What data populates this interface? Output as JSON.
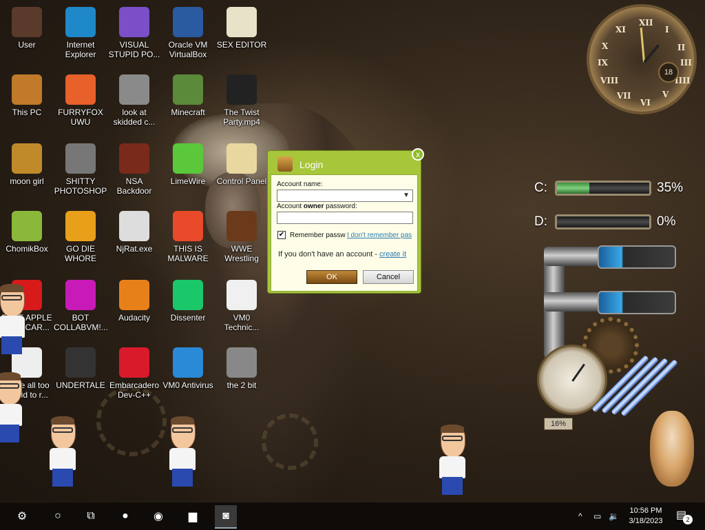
{
  "desktop": {
    "icons": [
      {
        "label": "User",
        "icon": "user-folder-icon",
        "color": "#5a3a2a"
      },
      {
        "label": "Internet Explorer",
        "icon": "edge-icon",
        "color": "#1e88c8"
      },
      {
        "label": "VISUAL STUPID PO...",
        "icon": "visual-studio-icon",
        "color": "#7a4fc8"
      },
      {
        "label": "Oracle VM VirtualBox",
        "icon": "virtualbox-icon",
        "color": "#2a5aa0"
      },
      {
        "label": "SEX EDITOR",
        "icon": "hxd-editor-icon",
        "color": "#e8e2c8"
      },
      {
        "label": "This PC",
        "icon": "this-pc-icon",
        "color": "#c07a2a"
      },
      {
        "label": "FURRYFOX UWU",
        "icon": "firefox-icon",
        "color": "#e8602a"
      },
      {
        "label": "look at skidded c...",
        "icon": "copies-icon",
        "color": "#8a8a8a"
      },
      {
        "label": "Minecraft",
        "icon": "minecraft-icon",
        "color": "#5a8a3a"
      },
      {
        "label": "The Twist Party.mp4",
        "icon": "video-file-icon",
        "color": "#222"
      },
      {
        "label": "moon girl",
        "icon": "moon-girl-icon",
        "color": "#c08a2a"
      },
      {
        "label": "SHITTY PHOTOSHOP",
        "icon": "gimp-icon",
        "color": "#777"
      },
      {
        "label": "NSA Backdoor",
        "icon": "nsa-backdoor-icon",
        "color": "#7a2a1a"
      },
      {
        "label": "LimeWire",
        "icon": "limewire-icon",
        "color": "#5ac83a"
      },
      {
        "label": "Control Panel",
        "icon": "lightbulb-icon",
        "color": "#e8d8a0"
      },
      {
        "label": "ChomikBox",
        "icon": "chomikbox-icon",
        "color": "#8ab83a"
      },
      {
        "label": "GO DIE WHORE",
        "icon": "die-icon",
        "color": "#e8a01a"
      },
      {
        "label": "NjRat.exe",
        "icon": "skull-icon",
        "color": "#ddd"
      },
      {
        "label": "THIS IS MALWARE",
        "icon": "chrome-icon",
        "color": "#e84a2a"
      },
      {
        "label": "WWE Wrestling",
        "icon": "tv-icon",
        "color": "#6a3a1a"
      },
      {
        "label": "FREE APPLE GIFT CAR...",
        "icon": "apple-icon",
        "color": "#d81a1a"
      },
      {
        "label": "BOT COLLABVM!...",
        "icon": "monitor-icon",
        "color": "#c81ab8"
      },
      {
        "label": "Audacity",
        "icon": "audacity-icon",
        "color": "#e8801a"
      },
      {
        "label": "Dissenter",
        "icon": "dissenter-icon",
        "color": "#1ac86a"
      },
      {
        "label": "VM0 Technic...",
        "icon": "technician-icon",
        "color": "#f0f0f0"
      },
      {
        "label": "youre all too stupid to r...",
        "icon": "portrait-icon",
        "color": "#eee"
      },
      {
        "label": "UNDERTALE",
        "icon": "unity-icon",
        "color": "#333"
      },
      {
        "label": "Embarcadero Dev-C++",
        "icon": "devcpp-icon",
        "color": "#d81a2a"
      },
      {
        "label": "VM0 Antivirus",
        "icon": "shield-icon",
        "color": "#2a8ad8"
      },
      {
        "label": "the 2 bit",
        "icon": "file-icon",
        "color": "#888"
      }
    ]
  },
  "clock_widget": {
    "numerals": [
      "XII",
      "I",
      "II",
      "III",
      "IIII",
      "V",
      "VI",
      "VII",
      "VIII",
      "IX",
      "X",
      "XI"
    ],
    "day": "18"
  },
  "drives": [
    {
      "letter": "C:",
      "percent": "35%",
      "fill": 0.35
    },
    {
      "letter": "D:",
      "percent": "0%",
      "fill": 0.0
    }
  ],
  "gauge": {
    "percent": "16%"
  },
  "login_dialog": {
    "title": "Login",
    "close_label": "x",
    "account_name_label": "Account name:",
    "account_name_value": "",
    "password_label_pre": "Account ",
    "password_label_bold": "owner",
    "password_label_post": " password:",
    "password_value": "",
    "remember_label": "Remember passw",
    "remember_checked": true,
    "forgot_link": "I don't remember pas",
    "no_account_text": "If you don't have an account - ",
    "create_link": "create it",
    "ok_label": "OK",
    "cancel_label": "Cancel",
    "accent": "#a7c63a"
  },
  "taskbar": {
    "items": [
      {
        "icon": "steampunk-start-icon",
        "glyph": "⚙"
      },
      {
        "icon": "cortana-icon",
        "glyph": "○"
      },
      {
        "icon": "task-view-icon",
        "glyph": "⧉"
      },
      {
        "icon": "dissenter-taskbar-icon",
        "glyph": "●"
      },
      {
        "icon": "chrome-taskbar-icon",
        "glyph": "◉"
      },
      {
        "icon": "file-explorer-icon",
        "glyph": "▆"
      },
      {
        "icon": "chomikbox-taskbar-icon",
        "glyph": "◙"
      }
    ],
    "tray_chevron": "^",
    "time": "10:56 PM",
    "date": "3/18/2023",
    "notification_count": "2"
  }
}
